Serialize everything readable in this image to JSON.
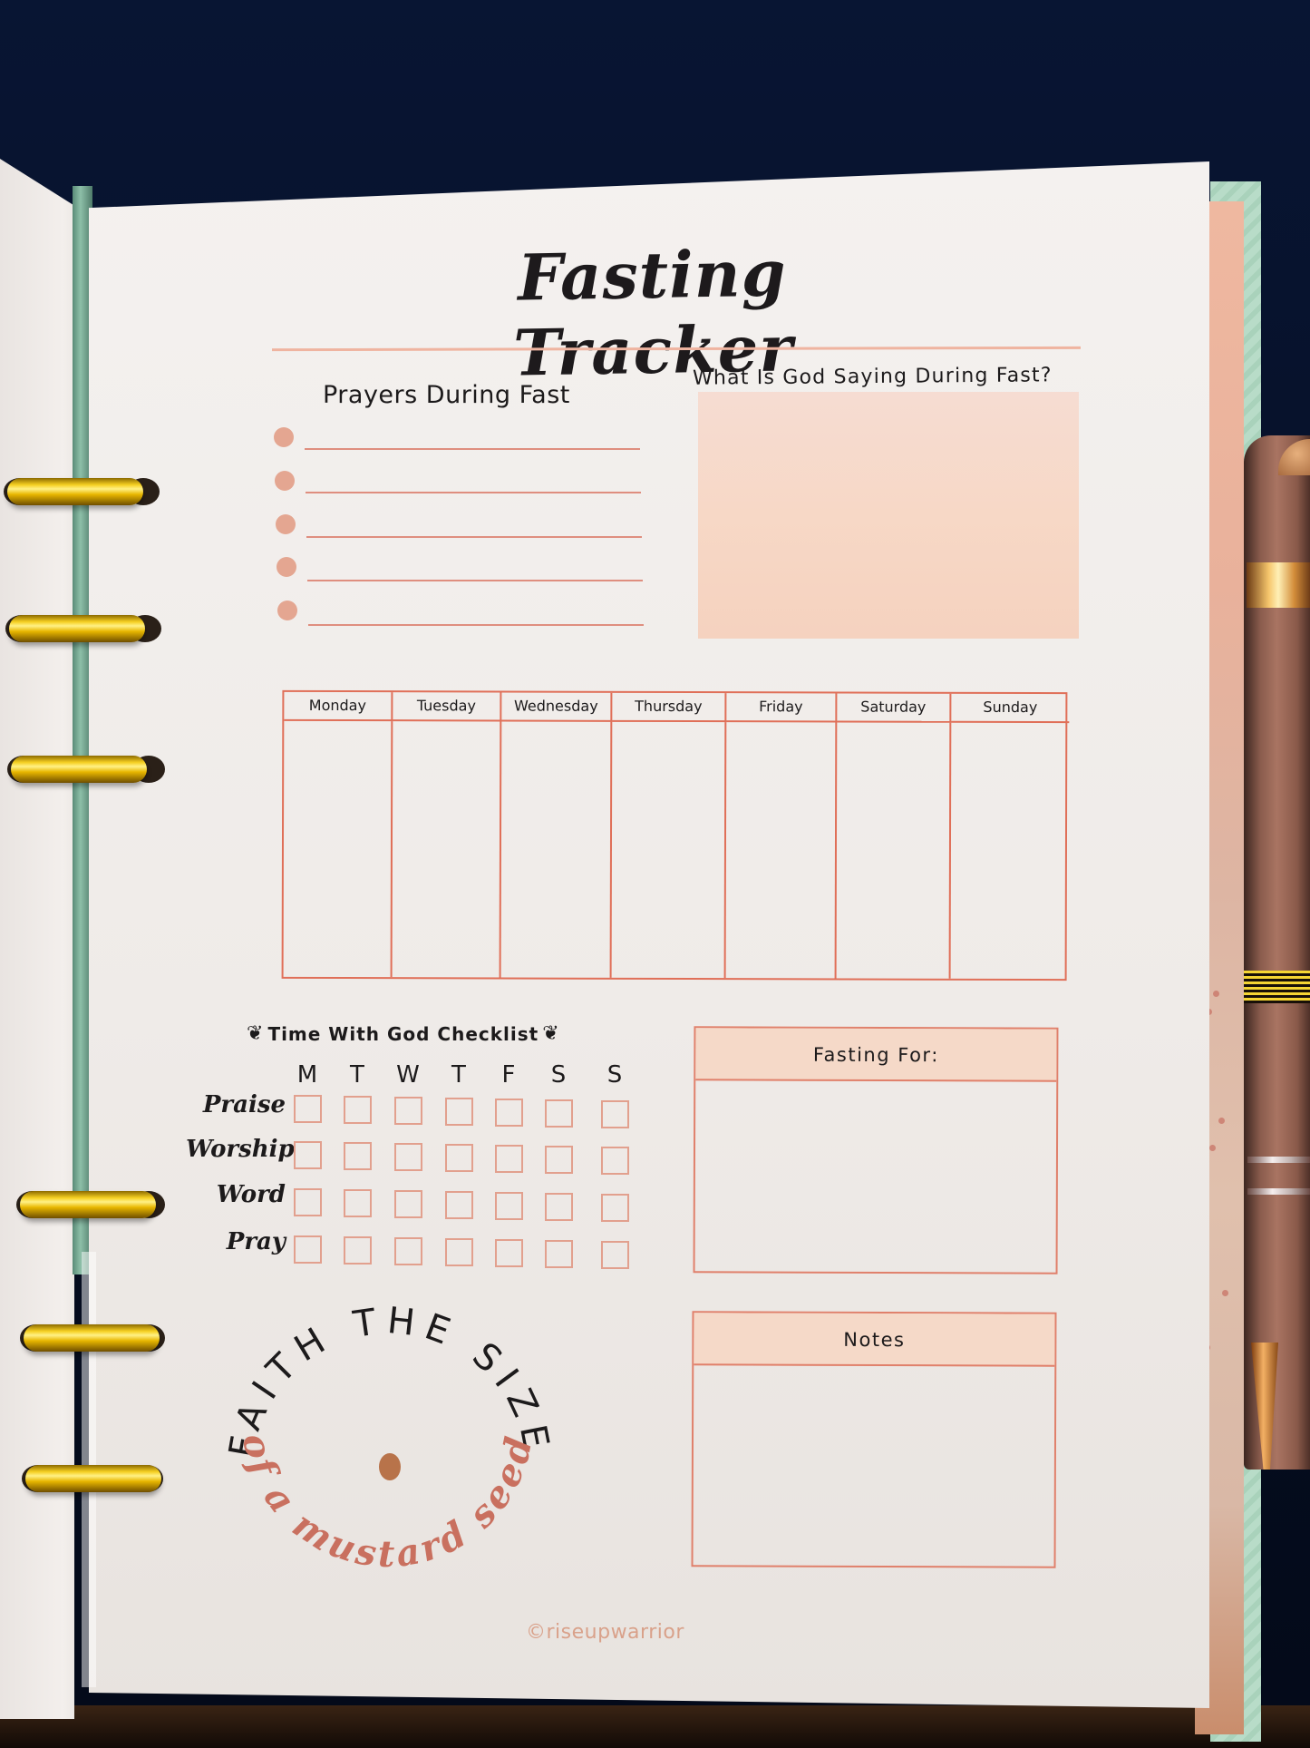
{
  "page": {
    "title": "Fasting Tracker",
    "prayers_section": {
      "heading": "Prayers During Fast",
      "lines": [
        "",
        "",
        "",
        "",
        ""
      ]
    },
    "god_saying_section": {
      "heading": "What Is God Saying During Fast?"
    },
    "weekly_table": {
      "days": [
        "Monday",
        "Tuesday",
        "Wednesday",
        "Thursday",
        "Friday",
        "Saturday",
        "Sunday"
      ]
    },
    "checklist": {
      "heading": "Time With God Checklist",
      "left_ornament": "❦",
      "right_ornament": "❦",
      "day_letters": [
        "M",
        "T",
        "W",
        "T",
        "F",
        "S",
        "S"
      ],
      "rows": [
        "Praise",
        "Worship",
        "Word",
        "Pray"
      ]
    },
    "fasting_for": {
      "heading": "Fasting For:"
    },
    "notes": {
      "heading": "Notes"
    },
    "quote": {
      "top_text": "FAITH THE SIZE",
      "bottom_text": "of a mustard seed"
    },
    "credit": "©riseupwarrior"
  },
  "colors": {
    "accent_line": "#e06f58",
    "bullet": "#e4a691",
    "header_fill": "#f5d9c8",
    "god_box_fill": "#f6dcd2",
    "seed": "#b8734a",
    "quote_bottom": "#c9705f",
    "background": "#07122a"
  }
}
